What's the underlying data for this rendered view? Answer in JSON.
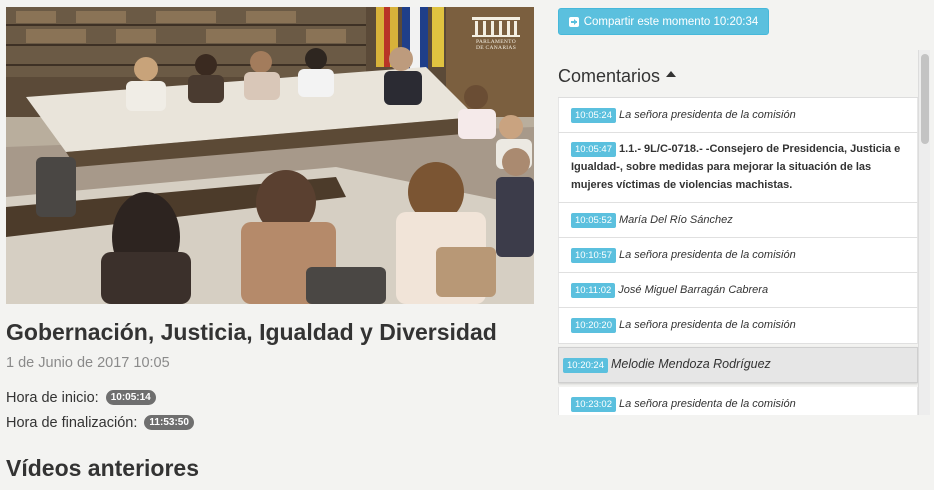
{
  "video": {
    "logo_text_line1": "Parlamento",
    "logo_text_line2": "de Canarias"
  },
  "session": {
    "title": "Gobernación, Justicia, Igualdad y Diversidad",
    "date": "1 de Junio de 2017 10:05",
    "start_label": "Hora de inicio:",
    "start_time": "10:05:14",
    "end_label": "Hora de finalización:",
    "end_time": "11:53:50"
  },
  "previous_videos": {
    "title": "Vídeos anteriores"
  },
  "share": {
    "label": "Compartir este momento 10:20:34",
    "icon": "share-square-icon"
  },
  "comments": {
    "heading": "Comentarios",
    "items": [
      {
        "time": "10:05:24",
        "text": "La señora presidenta de la comisión"
      },
      {
        "time": "10:05:47",
        "text": "1.1.- 9L/C-0718.- -Consejero de Presidencia, Justicia e Igualdad-, sobre medidas para mejorar la situación de las mujeres víctimas de violencias machistas."
      },
      {
        "time": "10:05:52",
        "text": "María Del Río Sánchez"
      },
      {
        "time": "10:10:57",
        "text": "La señora presidenta de la comisión"
      },
      {
        "time": "10:11:02",
        "text": "José Miguel Barragán Cabrera"
      },
      {
        "time": "10:20:20",
        "text": "La señora presidenta de la comisión"
      },
      {
        "time": "10:20:24",
        "text": "Melodie Mendoza Rodríguez"
      },
      {
        "time": "10:23:02",
        "text": "La señora presidenta de la comisión"
      }
    ]
  },
  "colors": {
    "accent": "#5bc0de",
    "pill": "#6f6f6f",
    "background": "#f3f3f1"
  }
}
